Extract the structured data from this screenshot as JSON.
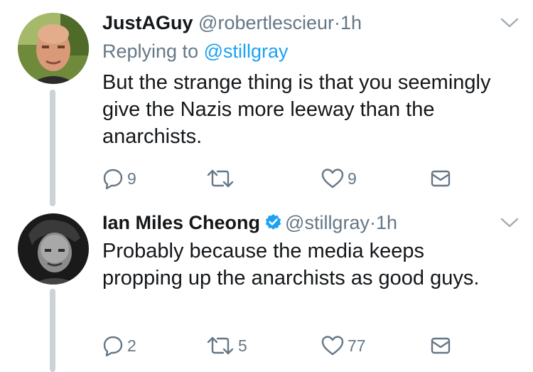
{
  "tweets": [
    {
      "name": "JustAGuy",
      "handle": "@robertlescieur",
      "separator": "·",
      "time": "1h",
      "replying_prefix": "Replying to",
      "replying_to": "@stillgray",
      "text": "But the strange thing is that you seemingly give the Nazis more leeway than the anarchists.",
      "replies": "9",
      "retweets": "",
      "likes": "9",
      "verified": false
    },
    {
      "name": "Ian Miles Cheong",
      "handle": "@stillgray",
      "separator": "·",
      "time": "1h",
      "text": "Probably because the media keeps propping up the anarchists as good guys.",
      "replies": "2",
      "retweets": "5",
      "likes": "77",
      "verified": true
    }
  ],
  "icons": {
    "reply": "reply-icon",
    "retweet": "retweet-icon",
    "like": "heart-icon",
    "dm": "envelope-icon",
    "caret": "chevron-down-icon",
    "verified": "verified-badge-icon"
  },
  "colors": {
    "text": "#14171a",
    "secondary": "#657786",
    "link": "#1da1f2",
    "thread_line": "#cbd2d8"
  }
}
